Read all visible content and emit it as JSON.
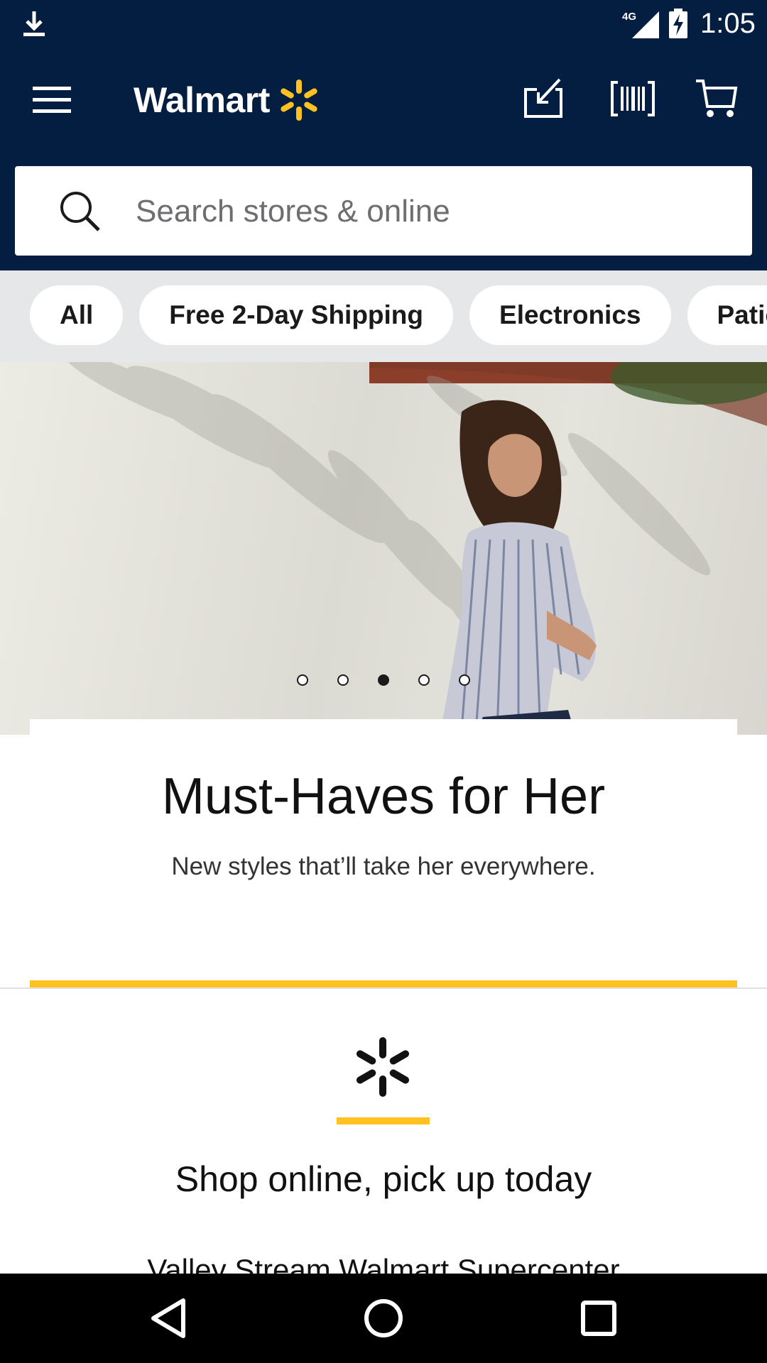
{
  "status_bar": {
    "network": "4G",
    "time": "1:05",
    "icons": [
      "download-icon",
      "signal-icon",
      "battery-charging-icon"
    ]
  },
  "header": {
    "logo_text": "Walmart",
    "brand_color": "#041e42",
    "accent_color": "#ffc220",
    "icons": [
      "menu-icon",
      "walmart-spark-icon",
      "reorder-icon",
      "barcode-scan-icon",
      "cart-icon"
    ]
  },
  "search": {
    "placeholder": "Search stores & online",
    "icon": "search-icon"
  },
  "chips": [
    {
      "label": "All"
    },
    {
      "label": "Free 2-Day Shipping"
    },
    {
      "label": "Electronics"
    },
    {
      "label": "Patio &"
    }
  ],
  "hero": {
    "slide_count": 5,
    "active_slide": 3,
    "title": "Must-Haves for Her",
    "subtitle": "New styles that’ll take her everywhere."
  },
  "pickup": {
    "icon": "walmart-spark-icon",
    "title": "Shop online, pick up today",
    "store": "Valley Stream Walmart Supercenter"
  },
  "navbar": {
    "icons": [
      "back-icon",
      "home-icon",
      "recents-icon"
    ]
  }
}
